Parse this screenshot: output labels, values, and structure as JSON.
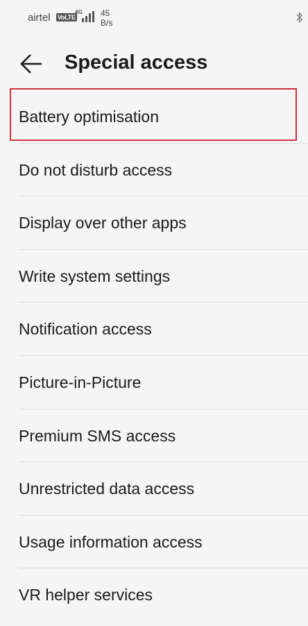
{
  "status_bar": {
    "carrier": "airtel",
    "volte": "VoLTE",
    "network": "4G",
    "speed_value": "45",
    "speed_unit": "B/s",
    "icons": [
      "signal-icon",
      "bluetooth-icon"
    ]
  },
  "header": {
    "title": "Special access",
    "back_icon": "back-arrow-icon"
  },
  "items": [
    {
      "label": "Battery optimisation"
    },
    {
      "label": "Do not disturb access"
    },
    {
      "label": "Display over other apps"
    },
    {
      "label": "Write system settings"
    },
    {
      "label": "Notification access"
    },
    {
      "label": "Picture-in-Picture"
    },
    {
      "label": "Premium SMS access"
    },
    {
      "label": "Unrestricted data access"
    },
    {
      "label": "Usage information access"
    },
    {
      "label": "VR helper services"
    }
  ],
  "colors": {
    "background": "#f5f5f5",
    "highlight": "#d0313b",
    "divider": "#dcdcdc"
  }
}
